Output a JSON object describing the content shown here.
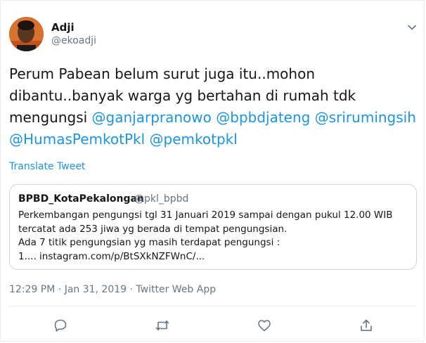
{
  "tweet": {
    "author_name": "Adji",
    "author_handle": "@ekoadji",
    "text_plain": "Perum Pabean belum surut juga itu..mohon dibantu..banyak warga yg bertahan di rumah tdk mengungsi ",
    "mentions": [
      "@ganjarpranowo",
      "@bpbdjateng",
      "@srirumingsih",
      "@HumasPemkotPkl",
      "@pemkotpkl"
    ],
    "translate_label": "Translate Tweet",
    "time": "12:29 PM",
    "date": "Jan 31, 2019",
    "source": "Twitter Web App",
    "separator": "·"
  },
  "quoted": {
    "author_name": "BPBD_KotaPekalongan",
    "author_handle": "@pkl_bpbd",
    "lines": [
      "Perkembangan pengungsi tgl 31 Januari 2019 sampai dengan pukul 12.00 WIB",
      "tercatat ada 253 jiwa yg berada di tempat pengungsian.",
      "Ada 7 titik pengungsian yg masih terdapat pengungsi :",
      "1.... instagram.com/p/BtSXkNZFWnC/..."
    ]
  },
  "actions": [
    {
      "name": "reply-icon"
    },
    {
      "name": "retweet-icon"
    },
    {
      "name": "like-icon"
    },
    {
      "name": "share-icon"
    }
  ],
  "colors": {
    "link": "#1b95e0",
    "secondary": "#657786",
    "border": "#ccd6dd"
  }
}
